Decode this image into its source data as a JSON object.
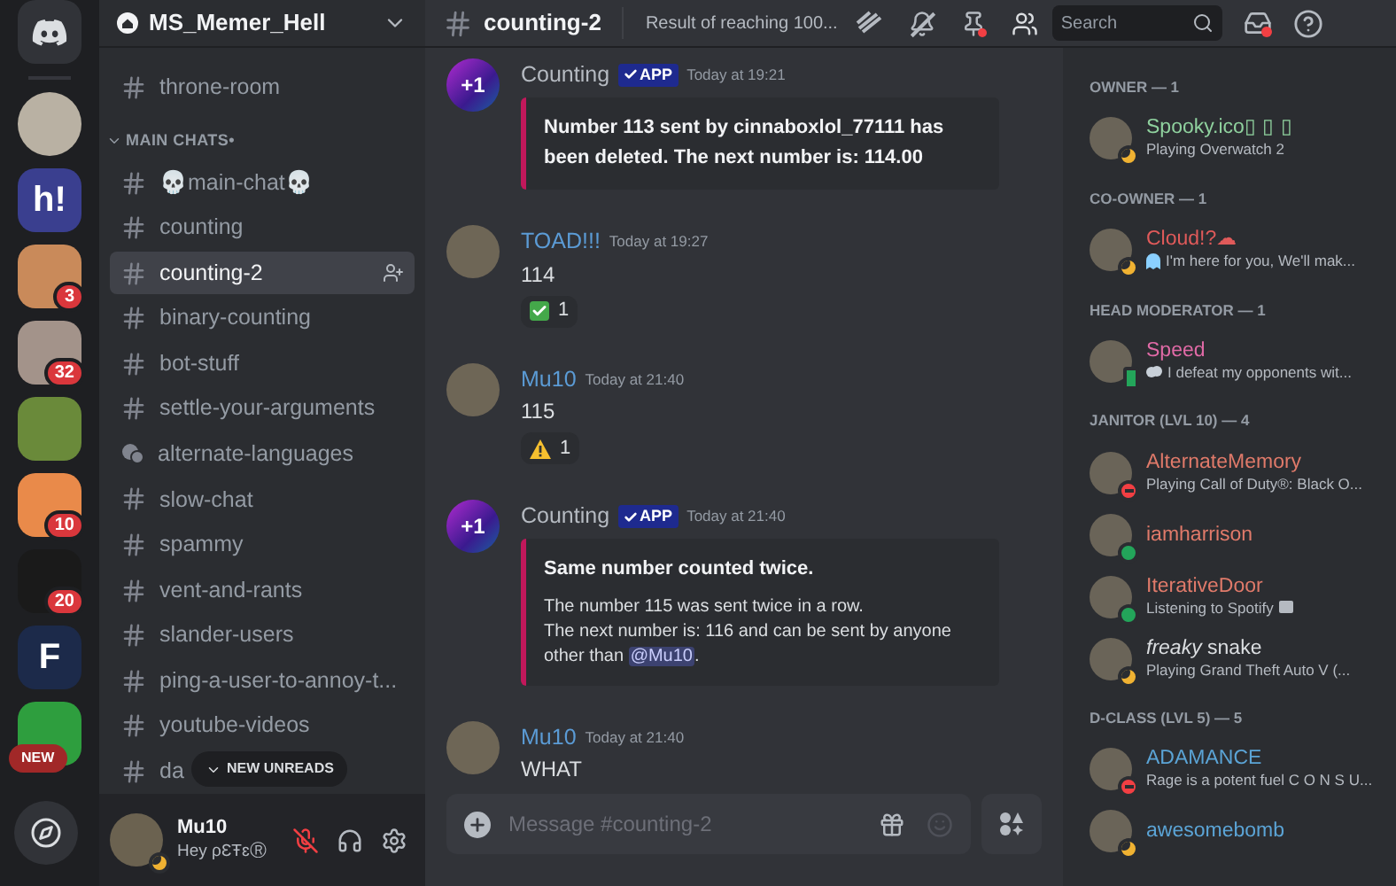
{
  "server_rail": {
    "servers": [
      {
        "kind": "photo"
      },
      {
        "kind": "logo",
        "label": "h!"
      },
      {
        "kind": "photo",
        "badge": "3"
      },
      {
        "kind": "photo",
        "badge": "32"
      },
      {
        "kind": "photo"
      },
      {
        "kind": "photo",
        "badge": "10"
      },
      {
        "kind": "photo",
        "badge": "20"
      },
      {
        "kind": "logo",
        "label": "F"
      },
      {
        "kind": "photo"
      }
    ],
    "new_pill": "NEW"
  },
  "channel_sidebar": {
    "server_name": "MS_Memer_Hell",
    "items": [
      {
        "kind": "channel",
        "name": "throne-room",
        "selected": false
      },
      {
        "kind": "category",
        "name": "MAIN CHATS•",
        "expanded": true
      },
      {
        "kind": "channel",
        "name": "💀main-chat💀",
        "selected": false
      },
      {
        "kind": "channel",
        "name": "counting",
        "selected": false
      },
      {
        "kind": "channel",
        "name": "counting-2",
        "selected": true
      },
      {
        "kind": "channel",
        "name": "binary-counting",
        "selected": false
      },
      {
        "kind": "channel",
        "name": "bot-stuff",
        "selected": false
      },
      {
        "kind": "channel",
        "name": "settle-your-arguments",
        "selected": false
      },
      {
        "kind": "forum",
        "name": "alternate-languages",
        "selected": false
      },
      {
        "kind": "channel",
        "name": "slow-chat",
        "selected": false
      },
      {
        "kind": "channel",
        "name": "spammy",
        "selected": false
      },
      {
        "kind": "channel",
        "name": "vent-and-rants",
        "selected": false
      },
      {
        "kind": "channel",
        "name": "slander-users",
        "selected": false
      },
      {
        "kind": "channel",
        "name": "ping-a-user-to-annoy-t...",
        "selected": false
      },
      {
        "kind": "channel",
        "name": "youtube-videos",
        "selected": false
      },
      {
        "kind": "channel",
        "name": "da",
        "selected": false
      }
    ],
    "new_unreads": "NEW UNREADS",
    "user": {
      "name": "Mu10",
      "status": "Hey ρƐŦɛⓇ",
      "mic_muted": true
    }
  },
  "header": {
    "channel": "counting-2",
    "topic": "Result of reaching 100...",
    "search_placeholder": "Search"
  },
  "messages": [
    {
      "kind": "embed",
      "author": "Counting",
      "color": "#b5bac1",
      "avatar_text": "+1",
      "app_tag": "APP",
      "time": "Today at 19:21",
      "embed_lines": [
        "Number 113 sent by cinnaboxlol_77111 has been deleted. The next number is: 114.00"
      ],
      "bold_body": true
    },
    {
      "kind": "text",
      "author": "TOAD!!!",
      "color": "#5b9bd5",
      "time": "Today at 19:27",
      "text": "114",
      "reaction": {
        "kind": "check",
        "count": "1"
      }
    },
    {
      "kind": "text",
      "author": "Mu10",
      "color": "#5b9bd5",
      "time": "Today at 21:40",
      "text": "115",
      "reaction": {
        "kind": "warning",
        "count": "1"
      }
    },
    {
      "kind": "embed",
      "author": "Counting",
      "color": "#b5bac1",
      "avatar_text": "+1",
      "app_tag": "APP",
      "time": "Today at 21:40",
      "embed_title": "Same number counted twice.",
      "embed_lines": [
        "The number 115 was sent twice in a row.",
        "The next number is: 116 and can be sent by anyone other than"
      ],
      "mention": "@Mu10",
      "embed_tail": ".",
      "bold_body": false
    },
    {
      "kind": "text",
      "author": "Mu10",
      "color": "#5b9bd5",
      "time": "Today at 21:40",
      "text": "WHAT"
    }
  ],
  "composer": {
    "placeholder": "Message #counting-2"
  },
  "member_list": {
    "groups": [
      {
        "title": "OWNER — 1",
        "members": [
          {
            "name": "Spooky.ico▯ ▯ ▯",
            "color": "#8fd19e",
            "kind": "idle",
            "activity": {
              "text": "Playing Overwatch 2"
            }
          }
        ]
      },
      {
        "title": "CO-OWNER — 1",
        "members": [
          {
            "name": "Cloud!?☁",
            "color": "#e05a5a",
            "kind": "idle",
            "activity": {
              "text": "I'm here for you, We'll mak...",
              "kind": "ghost"
            }
          }
        ]
      },
      {
        "title": "HEAD MODERATOR — 1",
        "members": [
          {
            "name": "Speed",
            "color": "#e06aa6",
            "kind": "mobile",
            "activity": {
              "text": "I defeat my opponents wit...",
              "kind": "cloud"
            }
          }
        ]
      },
      {
        "title": "JANITOR (LVL 10) — 4",
        "members": [
          {
            "name": "AlternateMemory",
            "color": "#e07a6a",
            "kind": "dnd",
            "activity": {
              "text": "Playing Call of Duty®: Black O..."
            }
          },
          {
            "name": "iamharrison",
            "color": "#e07a6a",
            "kind": "online"
          },
          {
            "name": "IterativeDoor",
            "color": "#e07a6a",
            "kind": "online",
            "activity": {
              "text": "Listening to Spotify"
            },
            "trailing_icon": true
          },
          {
            "name": "*freaky* snake",
            "color": "#dbdee1",
            "kind": "idle",
            "activity": {
              "text": "Playing Grand Theft Auto V (..."
            }
          }
        ]
      },
      {
        "title": "D-CLASS (LVL 5) — 5",
        "members": [
          {
            "name": "ADAMANCE",
            "color": "#5ba4d6",
            "kind": "dnd",
            "activity": {
              "text": "Rage is a potent fuel C O N S U..."
            }
          },
          {
            "name": "awesomebomb",
            "color": "#5ba4d6",
            "kind": "idle"
          }
        ]
      }
    ]
  }
}
